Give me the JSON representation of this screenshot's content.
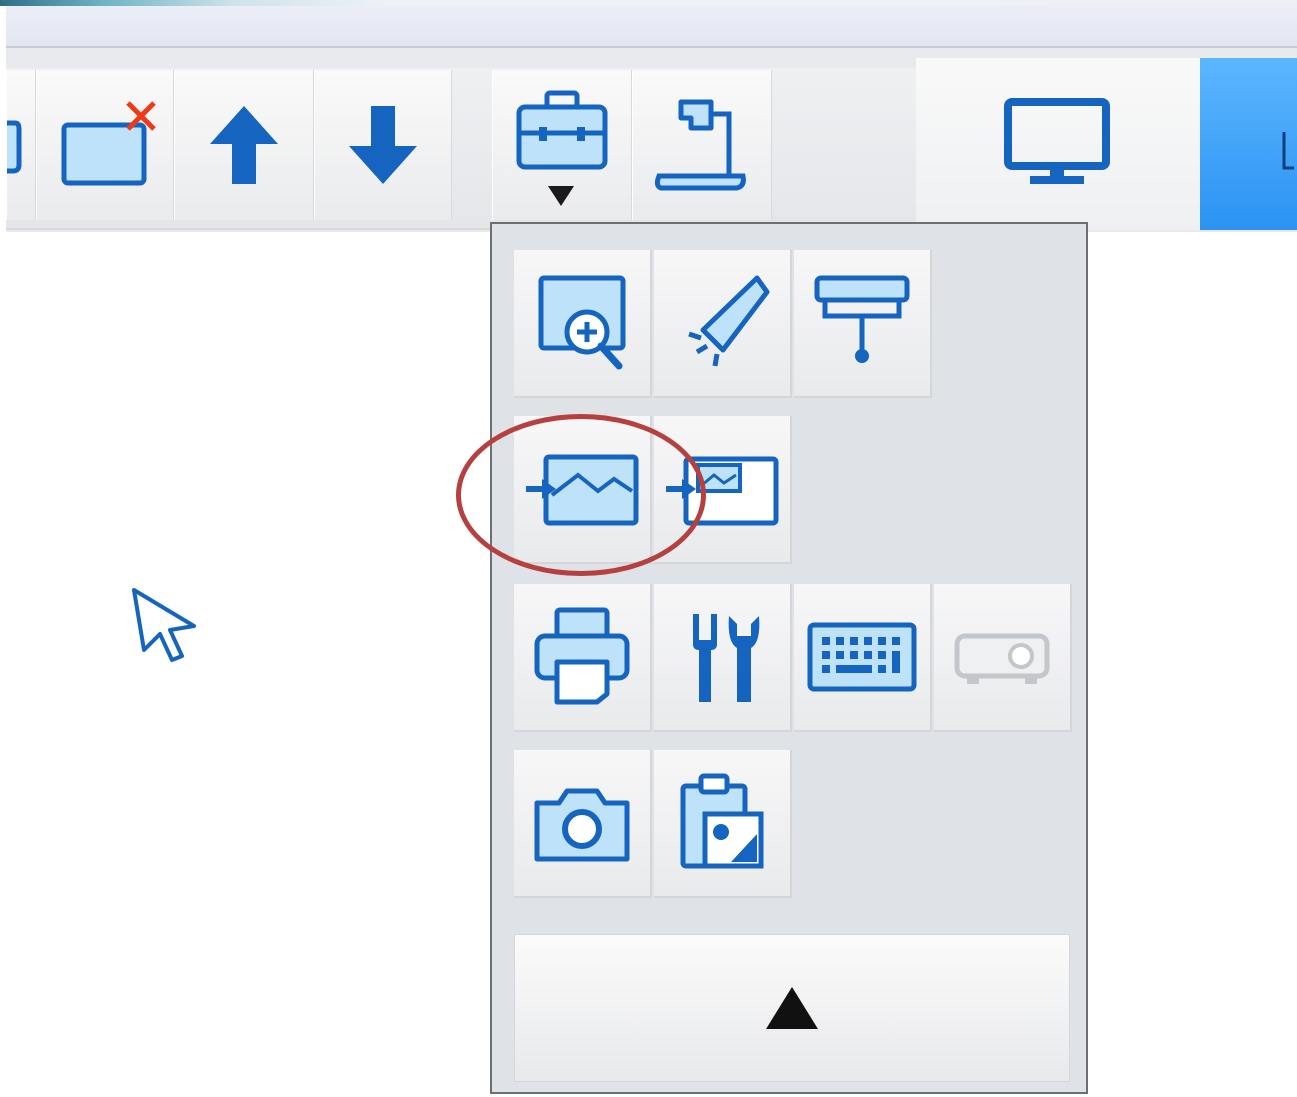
{
  "toolbar": {
    "buttons": [
      {
        "name": "partial-tool",
        "icon": "page-edge-icon"
      },
      {
        "name": "delete-page",
        "icon": "delete-page-icon"
      },
      {
        "name": "move-up",
        "icon": "arrow-up-icon"
      },
      {
        "name": "move-down",
        "icon": "arrow-down-icon"
      },
      {
        "name": "toolbox",
        "icon": "toolbox-icon",
        "has_dropdown": true
      },
      {
        "name": "document-camera",
        "icon": "document-camera-icon"
      }
    ],
    "display": {
      "icon": "monitor-icon"
    }
  },
  "toolbox_menu": {
    "rows": [
      [
        {
          "name": "magnifier",
          "icon": "screen-magnifier-icon"
        },
        {
          "name": "spotlight",
          "icon": "spotlight-icon"
        },
        {
          "name": "screen-shade",
          "icon": "screen-shade-icon"
        }
      ],
      [
        {
          "name": "insert-image",
          "icon": "insert-image-icon",
          "highlighted": true
        },
        {
          "name": "insert-background",
          "icon": "insert-background-icon"
        }
      ],
      [
        {
          "name": "print",
          "icon": "printer-icon"
        },
        {
          "name": "settings",
          "icon": "tools-icon"
        },
        {
          "name": "keyboard",
          "icon": "keyboard-icon"
        },
        {
          "name": "projector",
          "icon": "projector-icon",
          "disabled": true
        }
      ],
      [
        {
          "name": "camera",
          "icon": "camera-icon"
        },
        {
          "name": "clipboard-image",
          "icon": "clipboard-image-icon"
        }
      ]
    ],
    "collapse": {
      "icon": "collapse-up-icon"
    }
  },
  "colors": {
    "icon_blue": "#1565c0",
    "icon_fill": "#bfe2fb",
    "highlight": "#b5403f",
    "tab_blue": "#2a93f2"
  }
}
